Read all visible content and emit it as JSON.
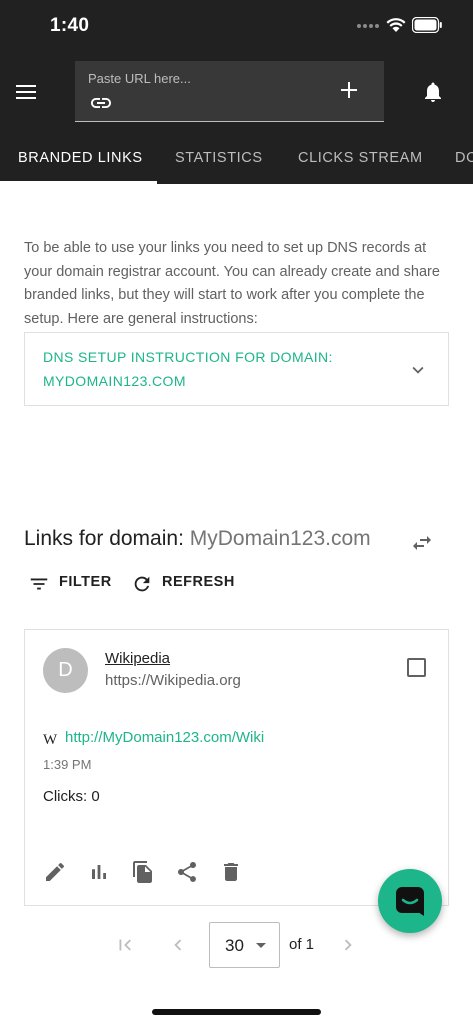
{
  "status_bar": {
    "time": "1:40"
  },
  "header": {
    "url_placeholder": "Paste URL here...",
    "icons": {
      "menu": "hamburger-menu-icon",
      "link": "link-icon",
      "add": "plus-icon",
      "notifications": "bell-icon"
    }
  },
  "tabs": [
    {
      "label": "BRANDED LINKS",
      "active": true
    },
    {
      "label": "STATISTICS",
      "active": false
    },
    {
      "label": "CLICKS STREAM",
      "active": false
    },
    {
      "label": "DO",
      "active": false
    }
  ],
  "notice": {
    "text": "To be able to use your links you need to set up DNS records at your domain registrar account. You can already create and share branded links, but they will start to work after you complete the setup. Here are general instructions:"
  },
  "dns_panel": {
    "title": "DNS SETUP INSTRUCTION FOR DOMAIN: MYDOMAIN123.COM"
  },
  "links_section": {
    "title_prefix": "Links for domain:",
    "domain": "MyDomain123.com",
    "filter_label": "FILTER",
    "refresh_label": "REFRESH"
  },
  "link_card": {
    "avatar_letter": "D",
    "title": "Wikipedia",
    "original_url": "https://Wikipedia.org",
    "favicon_letter": "W",
    "short_url": "http://MyDomain123.com/Wiki",
    "time": "1:39 PM",
    "clicks": "Clicks: 0",
    "actions": [
      "edit-icon",
      "stats-icon",
      "copy-icon",
      "share-icon",
      "delete-icon"
    ]
  },
  "pagination": {
    "page_size": "30",
    "of_label": "of 1"
  },
  "colors": {
    "accent": "#1db58a",
    "header_bg": "#212121"
  }
}
